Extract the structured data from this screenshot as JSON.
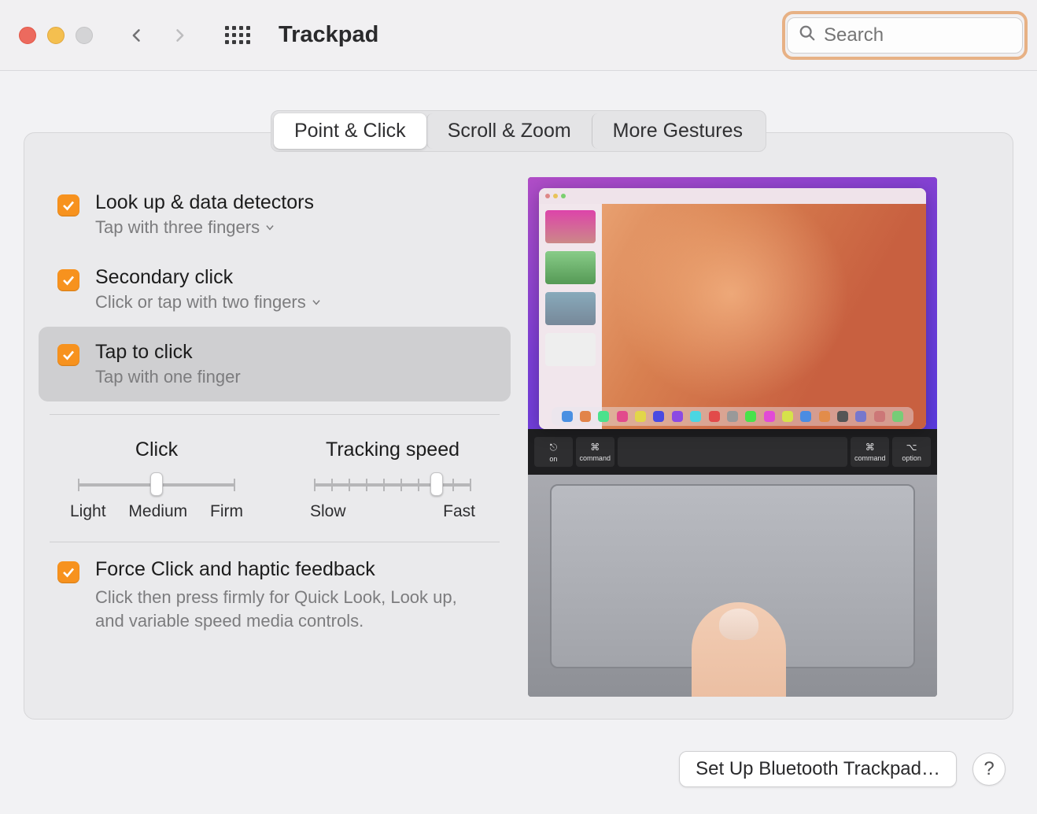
{
  "window": {
    "title": "Trackpad"
  },
  "search": {
    "placeholder": "Search"
  },
  "tabs": [
    {
      "label": "Point & Click",
      "active": true
    },
    {
      "label": "Scroll & Zoom",
      "active": false
    },
    {
      "label": "More Gestures",
      "active": false
    }
  ],
  "options": {
    "lookup": {
      "title": "Look up & data detectors",
      "sub": "Tap with three fingers",
      "checked": true,
      "has_submenu": true
    },
    "secondary": {
      "title": "Secondary click",
      "sub": "Click or tap with two fingers",
      "checked": true,
      "has_submenu": true
    },
    "tap": {
      "title": "Tap to click",
      "sub": "Tap with one finger",
      "checked": true,
      "has_submenu": false,
      "selected": true
    }
  },
  "sliders": {
    "click": {
      "title": "Click",
      "labels": [
        "Light",
        "Medium",
        "Firm"
      ],
      "value": 1,
      "ticks": 3
    },
    "tracking": {
      "title": "Tracking speed",
      "labels": [
        "Slow",
        "Fast"
      ],
      "value": 7,
      "ticks": 10
    }
  },
  "force": {
    "title": "Force Click and haptic feedback",
    "desc": "Click then press firmly for Quick Look, Look up, and variable speed media controls.",
    "checked": true
  },
  "footer": {
    "setup_label": "Set Up Bluetooth Trackpad…",
    "help_label": "?"
  },
  "preview": {
    "keys": [
      {
        "sym": "⎋",
        "label": "on"
      },
      {
        "sym": "⌘",
        "label": "command"
      },
      {
        "sym": "",
        "label": ""
      },
      {
        "sym": "⌘",
        "label": "command"
      },
      {
        "sym": "⌥",
        "label": "option"
      }
    ],
    "dock_colors": [
      "#4a90e2",
      "#e2844a",
      "#4ae28c",
      "#e24a8c",
      "#e2d64a",
      "#4a4ae2",
      "#8c4ae2",
      "#4ad6e2",
      "#e24a4a",
      "#999",
      "#4ae24a",
      "#e24ad6",
      "#d6e24a",
      "#4a8ce2",
      "#e28c4a",
      "#555",
      "#77c",
      "#c77",
      "#7c7"
    ]
  }
}
